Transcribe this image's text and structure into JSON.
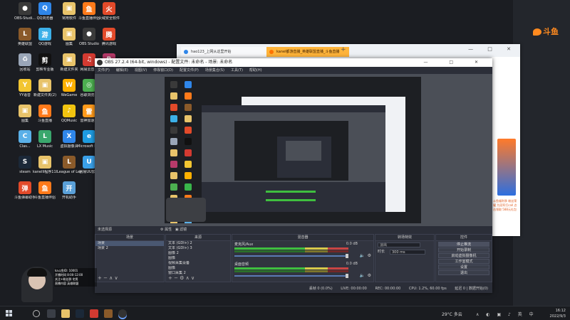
{
  "desktop": {
    "icons": [
      {
        "label": "OBS-Studi...",
        "color": "#3a3a3a",
        "glyph": "●"
      },
      {
        "label": "QQ浏览器",
        "color": "#2f86e9",
        "glyph": "Q"
      },
      {
        "label": "常用软件",
        "color": "#e8c36a",
        "glyph": "▣"
      },
      {
        "label": "斗鱼直播伴侣",
        "color": "#ff7a1a",
        "glyph": "鱼"
      },
      {
        "label": "火绒安全软件",
        "color": "#e24a2a",
        "glyph": "火"
      },
      {
        "label": "英雄联盟",
        "color": "#8a5a2a",
        "glyph": "L"
      },
      {
        "label": "QQ游戏",
        "color": "#3cb0e8",
        "glyph": "游"
      },
      {
        "label": "图集",
        "color": "#e8c36a",
        "glyph": "▣"
      },
      {
        "label": "OBS Studio",
        "color": "#3a3a3a",
        "glyph": "●"
      },
      {
        "label": "腾讯游戏",
        "color": "#e24a2a",
        "glyph": "腾"
      },
      {
        "label": "回收站",
        "color": "#9aa6b8",
        "glyph": "♻"
      },
      {
        "label": "剪映专业版",
        "color": "#111111",
        "glyph": "剪"
      },
      {
        "label": "新建文件夹",
        "color": "#e8c36a",
        "glyph": "▣"
      },
      {
        "label": "网易云音乐",
        "color": "#d33a31",
        "glyph": "♫"
      },
      {
        "label": "专业",
        "color": "#b83a6a",
        "glyph": "R"
      },
      {
        "label": "YY语音",
        "color": "#f2c531",
        "glyph": "Y"
      },
      {
        "label": "新建文件夹(2)",
        "color": "#e8c36a",
        "glyph": "▣"
      },
      {
        "label": "WeGame",
        "color": "#ffb000",
        "glyph": "W"
      },
      {
        "label": "谷歌浏览器",
        "color": "#4caf50",
        "glyph": "◎"
      },
      {
        "label": "微信",
        "color": "#39b54a",
        "glyph": "微"
      },
      {
        "label": "图集",
        "color": "#e8c36a",
        "glyph": "▣"
      },
      {
        "label": "斗鱼直播",
        "color": "#ff7a1a",
        "glyph": "鱼"
      },
      {
        "label": "QQMusic",
        "color": "#f1c40f",
        "glyph": "♪"
      },
      {
        "label": "雷神加速器",
        "color": "#ff9a1a",
        "glyph": "雷"
      },
      {
        "label": "专业",
        "color": "#e8c36a",
        "glyph": "▣"
      },
      {
        "label": "Clas...",
        "color": "#5ab0e8",
        "glyph": "C"
      },
      {
        "label": "LX Music",
        "color": "#3aa76d",
        "glyph": "L"
      },
      {
        "label": "虚拟摄像头",
        "color": "#2f86e9",
        "glyph": "X"
      },
      {
        "label": "Microsoft Edge",
        "color": "#1e9be0",
        "glyph": "e"
      },
      {
        "label": "ToDesk",
        "color": "#2f86e9",
        "glyph": "T"
      },
      {
        "label": "steam",
        "color": "#1b2838",
        "glyph": "S"
      },
      {
        "label": "kanelli程序1100",
        "color": "#e8c36a",
        "glyph": "▣"
      },
      {
        "label": "League of Legends",
        "color": "#8a5a2a",
        "glyph": "L"
      },
      {
        "label": "网易UU加速",
        "color": "#3aa0e8",
        "glyph": "U"
      },
      {
        "label": "YY开播",
        "color": "#f2c531",
        "glyph": "Y"
      },
      {
        "label": "斗鱼弹幕助手",
        "color": "#e24a2a",
        "glyph": "弹"
      },
      {
        "label": "斗鱼直播伴侣",
        "color": "#ff7a1a",
        "glyph": "鱼"
      },
      {
        "label": "开机助手",
        "color": "#5aa0d8",
        "glyph": "开"
      }
    ],
    "douyu_brand": "斗鱼"
  },
  "browser": {
    "tab1": "hao123_上网从这里开始",
    "tab2": "kanel都游直播_英雄联盟直播_斗鱼直播",
    "new_tab": "+",
    "controls": "— □ ✕",
    "ad_text": "斗鱼福利季 粉丝荣耀 为冠军打call 点击领取 588元礼包"
  },
  "obs": {
    "title": "OBS 27.2.4 (64-bit, windows) - 配置文件: 未命名 - 场景: 未命名",
    "controls": "— □ ✕",
    "menu": [
      "文件(F)",
      "编辑(E)",
      "视图(V)",
      "停靠窗口(D)",
      "配置文件(P)",
      "场景集合(S)",
      "工具(T)",
      "帮助(H)"
    ],
    "scene_line": {
      "label": "未选择源",
      "props": "⚙ 属性",
      "filters": "▣ 滤镜"
    },
    "scenes": {
      "header": "场景",
      "items": [
        "场景",
        "场景 2"
      ],
      "footer": "+  −  ∧  ∨"
    },
    "sources": {
      "header": "来源",
      "items": [
        "文本 (GDI+) 2",
        "文本 (GDI+) 3",
        "图像 2",
        "图像",
        "视频采集设备",
        "图像",
        "窗口采集 2"
      ],
      "footer": "+  −  ⚙  ∧  ∨"
    },
    "mixer": {
      "header": "混音器",
      "channels": [
        {
          "name": "麦克风/Aux",
          "db": "0.0 dB"
        },
        {
          "name": "桌面音频",
          "db": "0.0 dB"
        }
      ]
    },
    "transitions": {
      "header": "转场特效",
      "type_label": "淡出",
      "duration_label": "时长",
      "duration_value": "300 ms"
    },
    "controls_dock": {
      "header": "控件",
      "buttons": [
        "停止推流",
        "开始录制",
        "启动虚拟摄像机",
        "工作室模式",
        "设置",
        "退出"
      ]
    },
    "statusbar": {
      "dropped": "丢帧 0 (0.0%)",
      "live": "LIVE: 00:00:00",
      "rec": "REC: 00:00:00",
      "cpu": "CPU: 1.2%, 60.00 fps",
      "bitrate": "延迟 0 | 数据开始(0)"
    }
  },
  "overlay": {
    "lines": [
      "ka斗鱼ID: 10001",
      "开播时间 8:00-12:00",
      "关注+粉丝群 宅男",
      "直播内容 英雄联盟"
    ]
  },
  "taskbar": {
    "weather": "29°C 多云",
    "time": "16:12",
    "date": "2022/9/3",
    "tray_icons": "∧ ◐ ▣ ♪ 英 中"
  }
}
